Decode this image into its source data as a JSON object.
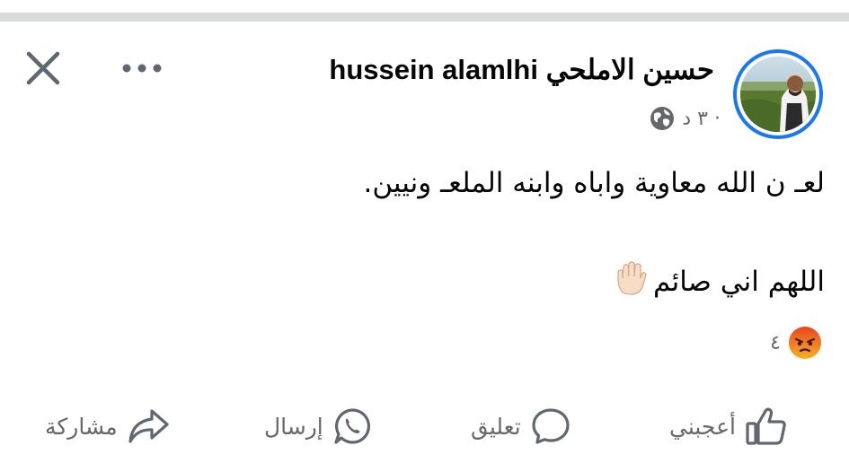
{
  "post": {
    "author_name": "hussein alamlhi حسين الاملحي",
    "timestamp": "٣ د ·",
    "visibility_icon": "globe-icon",
    "text_line1": "لعـ ن الله معاوية واباه وابنه الملعـ ونيين.",
    "text_line2": "اللهم اني صائم"
  },
  "reactions": {
    "icon": "angry-reaction-icon",
    "count": "٤"
  },
  "actions": {
    "like": "أعجبني",
    "comment": "تعليق",
    "send": "إرسال",
    "share": "مشاركة"
  },
  "colors": {
    "accent": "#1877f2",
    "secondary_text": "#65676b",
    "icon_gray": "#606770"
  }
}
